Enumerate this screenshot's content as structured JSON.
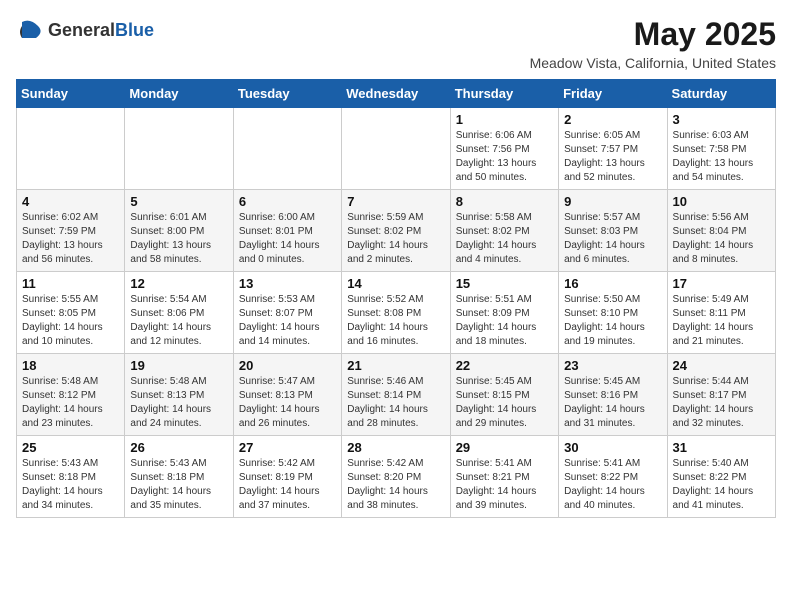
{
  "logo": {
    "general": "General",
    "blue": "Blue"
  },
  "title": "May 2025",
  "subtitle": "Meadow Vista, California, United States",
  "weekdays": [
    "Sunday",
    "Monday",
    "Tuesday",
    "Wednesday",
    "Thursday",
    "Friday",
    "Saturday"
  ],
  "weeks": [
    [
      {
        "day": "",
        "info": ""
      },
      {
        "day": "",
        "info": ""
      },
      {
        "day": "",
        "info": ""
      },
      {
        "day": "",
        "info": ""
      },
      {
        "day": "1",
        "info": "Sunrise: 6:06 AM\nSunset: 7:56 PM\nDaylight: 13 hours\nand 50 minutes."
      },
      {
        "day": "2",
        "info": "Sunrise: 6:05 AM\nSunset: 7:57 PM\nDaylight: 13 hours\nand 52 minutes."
      },
      {
        "day": "3",
        "info": "Sunrise: 6:03 AM\nSunset: 7:58 PM\nDaylight: 13 hours\nand 54 minutes."
      }
    ],
    [
      {
        "day": "4",
        "info": "Sunrise: 6:02 AM\nSunset: 7:59 PM\nDaylight: 13 hours\nand 56 minutes."
      },
      {
        "day": "5",
        "info": "Sunrise: 6:01 AM\nSunset: 8:00 PM\nDaylight: 13 hours\nand 58 minutes."
      },
      {
        "day": "6",
        "info": "Sunrise: 6:00 AM\nSunset: 8:01 PM\nDaylight: 14 hours\nand 0 minutes."
      },
      {
        "day": "7",
        "info": "Sunrise: 5:59 AM\nSunset: 8:02 PM\nDaylight: 14 hours\nand 2 minutes."
      },
      {
        "day": "8",
        "info": "Sunrise: 5:58 AM\nSunset: 8:02 PM\nDaylight: 14 hours\nand 4 minutes."
      },
      {
        "day": "9",
        "info": "Sunrise: 5:57 AM\nSunset: 8:03 PM\nDaylight: 14 hours\nand 6 minutes."
      },
      {
        "day": "10",
        "info": "Sunrise: 5:56 AM\nSunset: 8:04 PM\nDaylight: 14 hours\nand 8 minutes."
      }
    ],
    [
      {
        "day": "11",
        "info": "Sunrise: 5:55 AM\nSunset: 8:05 PM\nDaylight: 14 hours\nand 10 minutes."
      },
      {
        "day": "12",
        "info": "Sunrise: 5:54 AM\nSunset: 8:06 PM\nDaylight: 14 hours\nand 12 minutes."
      },
      {
        "day": "13",
        "info": "Sunrise: 5:53 AM\nSunset: 8:07 PM\nDaylight: 14 hours\nand 14 minutes."
      },
      {
        "day": "14",
        "info": "Sunrise: 5:52 AM\nSunset: 8:08 PM\nDaylight: 14 hours\nand 16 minutes."
      },
      {
        "day": "15",
        "info": "Sunrise: 5:51 AM\nSunset: 8:09 PM\nDaylight: 14 hours\nand 18 minutes."
      },
      {
        "day": "16",
        "info": "Sunrise: 5:50 AM\nSunset: 8:10 PM\nDaylight: 14 hours\nand 19 minutes."
      },
      {
        "day": "17",
        "info": "Sunrise: 5:49 AM\nSunset: 8:11 PM\nDaylight: 14 hours\nand 21 minutes."
      }
    ],
    [
      {
        "day": "18",
        "info": "Sunrise: 5:48 AM\nSunset: 8:12 PM\nDaylight: 14 hours\nand 23 minutes."
      },
      {
        "day": "19",
        "info": "Sunrise: 5:48 AM\nSunset: 8:13 PM\nDaylight: 14 hours\nand 24 minutes."
      },
      {
        "day": "20",
        "info": "Sunrise: 5:47 AM\nSunset: 8:13 PM\nDaylight: 14 hours\nand 26 minutes."
      },
      {
        "day": "21",
        "info": "Sunrise: 5:46 AM\nSunset: 8:14 PM\nDaylight: 14 hours\nand 28 minutes."
      },
      {
        "day": "22",
        "info": "Sunrise: 5:45 AM\nSunset: 8:15 PM\nDaylight: 14 hours\nand 29 minutes."
      },
      {
        "day": "23",
        "info": "Sunrise: 5:45 AM\nSunset: 8:16 PM\nDaylight: 14 hours\nand 31 minutes."
      },
      {
        "day": "24",
        "info": "Sunrise: 5:44 AM\nSunset: 8:17 PM\nDaylight: 14 hours\nand 32 minutes."
      }
    ],
    [
      {
        "day": "25",
        "info": "Sunrise: 5:43 AM\nSunset: 8:18 PM\nDaylight: 14 hours\nand 34 minutes."
      },
      {
        "day": "26",
        "info": "Sunrise: 5:43 AM\nSunset: 8:18 PM\nDaylight: 14 hours\nand 35 minutes."
      },
      {
        "day": "27",
        "info": "Sunrise: 5:42 AM\nSunset: 8:19 PM\nDaylight: 14 hours\nand 37 minutes."
      },
      {
        "day": "28",
        "info": "Sunrise: 5:42 AM\nSunset: 8:20 PM\nDaylight: 14 hours\nand 38 minutes."
      },
      {
        "day": "29",
        "info": "Sunrise: 5:41 AM\nSunset: 8:21 PM\nDaylight: 14 hours\nand 39 minutes."
      },
      {
        "day": "30",
        "info": "Sunrise: 5:41 AM\nSunset: 8:22 PM\nDaylight: 14 hours\nand 40 minutes."
      },
      {
        "day": "31",
        "info": "Sunrise: 5:40 AM\nSunset: 8:22 PM\nDaylight: 14 hours\nand 41 minutes."
      }
    ]
  ]
}
